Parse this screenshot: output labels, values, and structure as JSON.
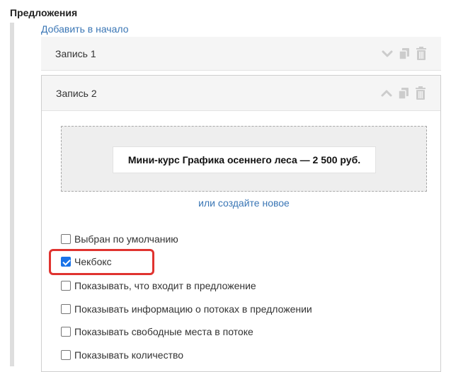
{
  "section": {
    "title": "Предложения"
  },
  "add_link": "Добавить в начало",
  "records": [
    {
      "title": "Запись 1",
      "expanded": false
    },
    {
      "title": "Запись 2",
      "expanded": true
    }
  ],
  "offer": {
    "name": "Мини-курс Графика осеннего леса — 2 500 руб."
  },
  "create_link": "или создайте новое",
  "checkboxes": [
    {
      "label": "Выбран по умолчанию",
      "checked": false
    },
    {
      "label": "Чекбокс",
      "checked": true
    },
    {
      "label": "Показывать, что входит в предложение",
      "checked": false
    },
    {
      "label": "Показывать информацию о потоках в предложении",
      "checked": false
    },
    {
      "label": "Показывать свободные места в потоке",
      "checked": false
    },
    {
      "label": "Показывать количество",
      "checked": false
    }
  ],
  "colors": {
    "link": "#3a76b5",
    "highlight": "#e0332f",
    "checkbox_checked": "#1a73e8"
  }
}
